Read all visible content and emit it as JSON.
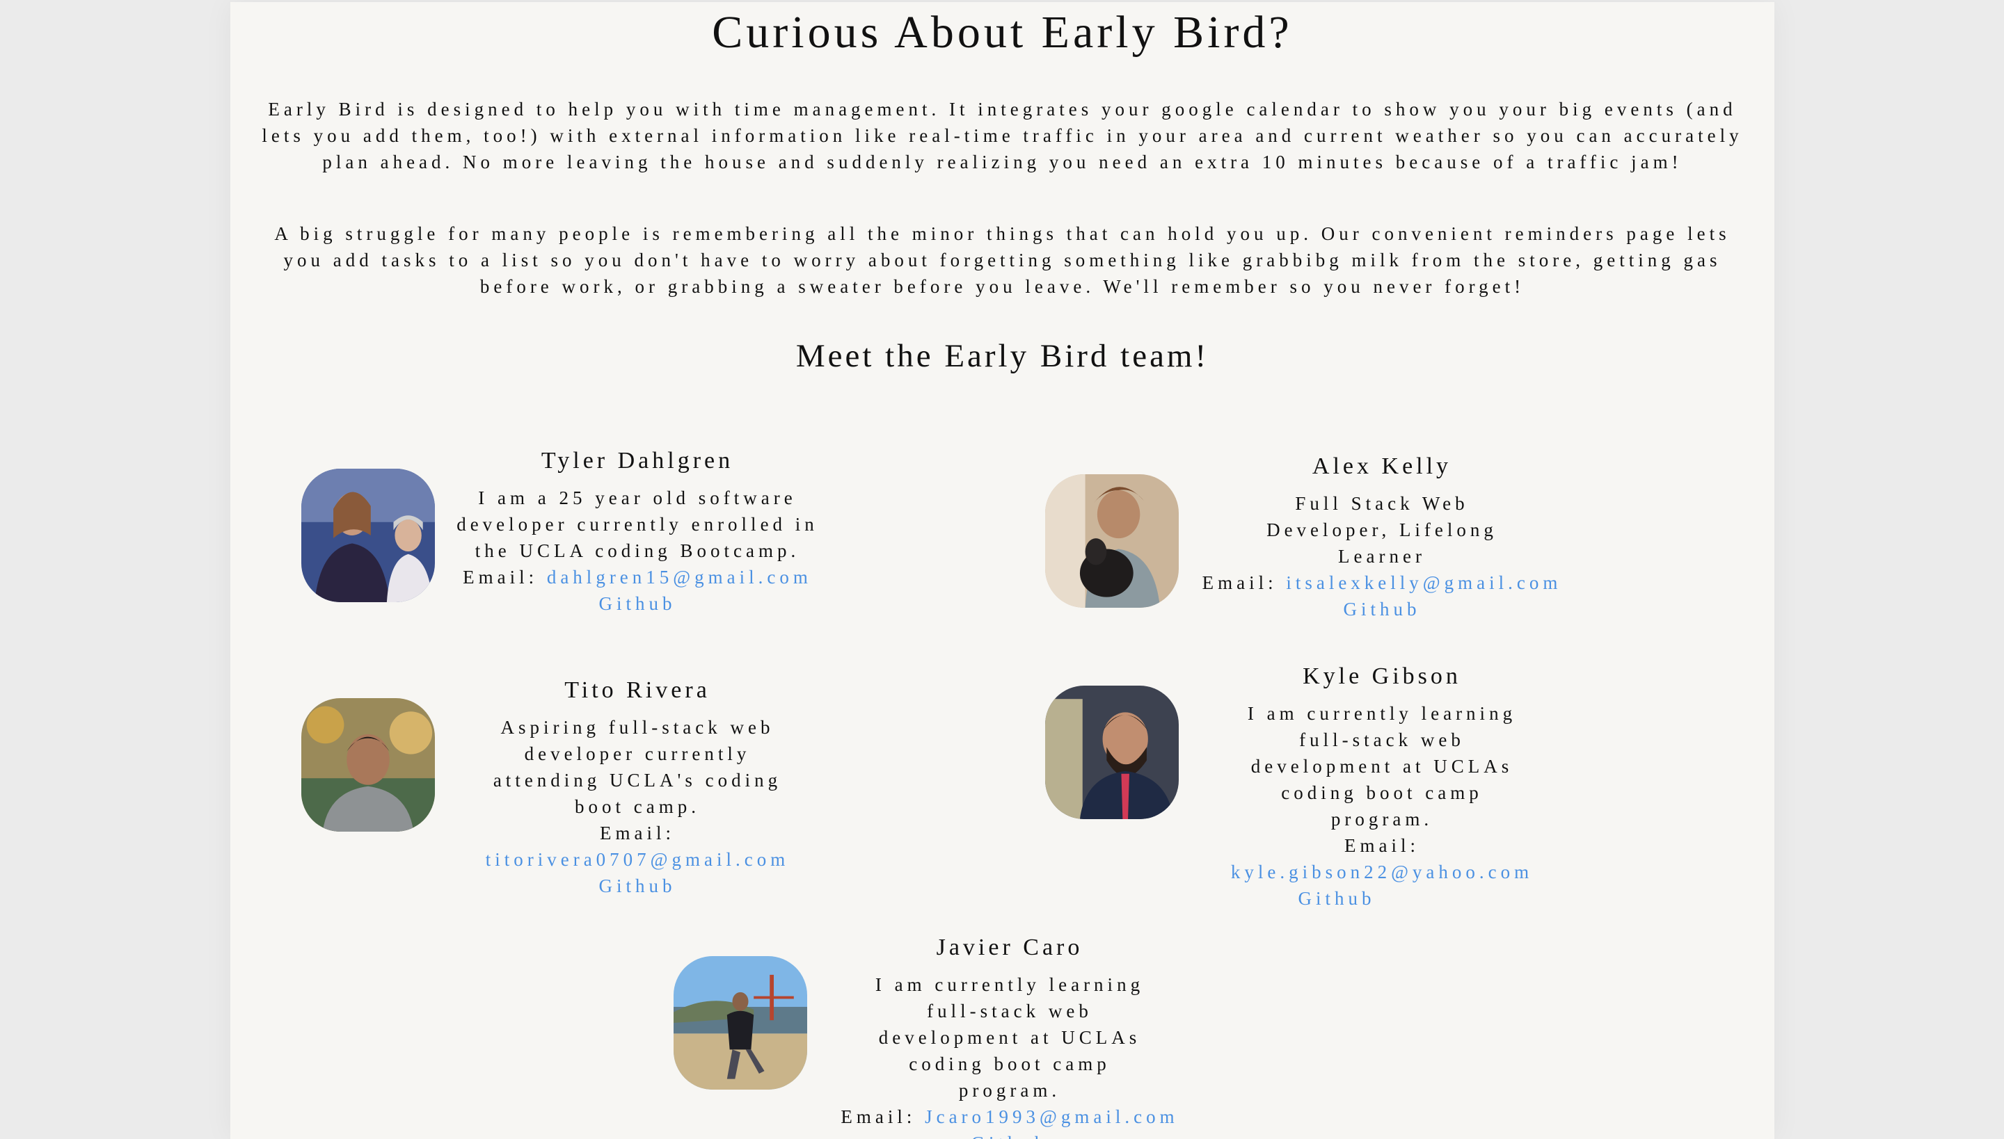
{
  "page_title": "Curious About Early Bird?",
  "intro": [
    "Early Bird is designed to help you with time management. It integrates your google calendar to show you your big events (and lets you add them, too!) with external information like real-time traffic in your area and current weather so you can accurately plan ahead. No more leaving the house and suddenly realizing you need an extra 10 minutes because of a traffic jam!",
    "A big struggle for many people is remembering all the minor things that can hold you up. Our convenient reminders page lets you add tasks to a list so you don't have to worry about forgetting something like grabbibg milk from the store, getting gas before work, or grabbing a sweater before you leave. We'll remember so you never forget!"
  ],
  "team_heading": "Meet the Early Bird team!",
  "members": [
    {
      "name": "Tyler Dahlgren",
      "bio": "I am a 25 year old software developer currently enrolled in the UCLA coding Bootcamp.",
      "email_label": "Email:",
      "email": "dahlgren15@gmail.com",
      "github": "Github"
    },
    {
      "name": "Alex Kelly",
      "bio": "Full Stack Web Developer, Lifelong Learner",
      "email_label": "Email:",
      "email": "itsalexkelly@gmail.com",
      "github": "Github"
    },
    {
      "name": "Tito Rivera",
      "bio": "Aspiring full-stack web developer currently attending UCLA's coding boot camp.",
      "email_label": "Email:",
      "email": "titorivera0707@gmail.com",
      "github": "Github"
    },
    {
      "name": "Kyle Gibson",
      "bio": "I am currently learning full-stack web development at UCLAs coding boot camp program.",
      "email_label": "Email:",
      "email": "kyle.gibson22@yahoo.com",
      "github": "Github"
    },
    {
      "name": "Javier Caro",
      "bio": "I am currently learning full-stack web development at UCLAs coding boot camp program.",
      "email_label": "Email:",
      "email": "Jcaro1993@gmail.com",
      "github": "Github"
    }
  ],
  "colors": {
    "link": "#4a90e2",
    "background": "#f7f6f3",
    "gutter": "#ebebeb"
  }
}
